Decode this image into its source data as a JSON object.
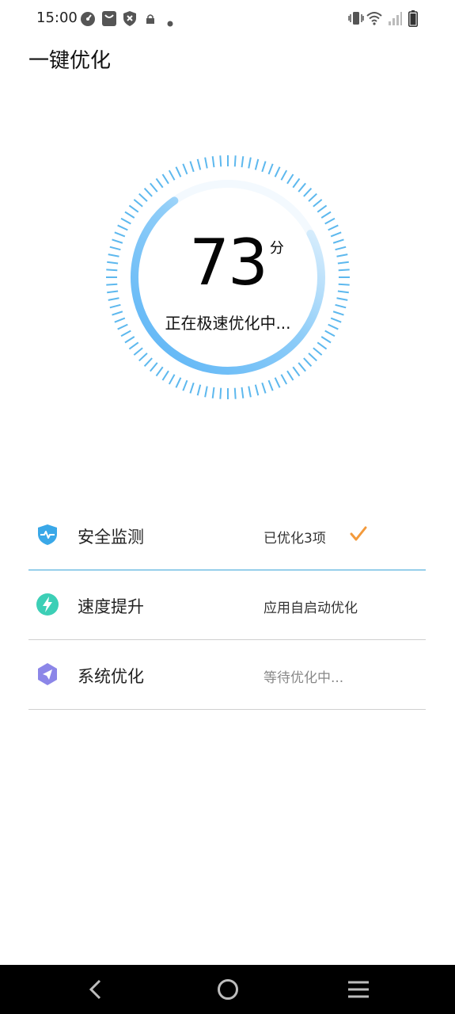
{
  "status_bar": {
    "time": "15:00",
    "icons": [
      "speedometer-icon",
      "bag-icon",
      "shield-x-icon",
      "lock-icon",
      "dot-icon",
      "vibrate-icon",
      "wifi-icon",
      "signal-icon",
      "battery-icon"
    ]
  },
  "header": {
    "title": "一键优化"
  },
  "gauge": {
    "score": "73",
    "unit": "分",
    "status": "正在极速优化中...",
    "progress_fraction": 0.73,
    "colors": {
      "tick": "#5db8ee",
      "arc_start": "#5ab4f6",
      "arc_end": "#e8f4fd"
    }
  },
  "items": [
    {
      "label": "安全监测",
      "status": "已优化3项",
      "icon": "shield-pulse-icon",
      "done": true
    },
    {
      "label": "速度提升",
      "status": "应用自启动优化",
      "icon": "lightning-icon",
      "done": false
    },
    {
      "label": "系统优化",
      "status": "等待优化中...",
      "icon": "send-hexagon-icon",
      "done": false
    }
  ],
  "nav": {
    "buttons": [
      "back-icon",
      "home-icon",
      "menu-icon"
    ]
  },
  "colors": {
    "accent_blue": "#3aa4d8",
    "check_orange": "#f39a3b",
    "icon_shield": "#3aa8e8",
    "icon_bolt": "#3ccfb6",
    "icon_system": "#8c86e8"
  }
}
